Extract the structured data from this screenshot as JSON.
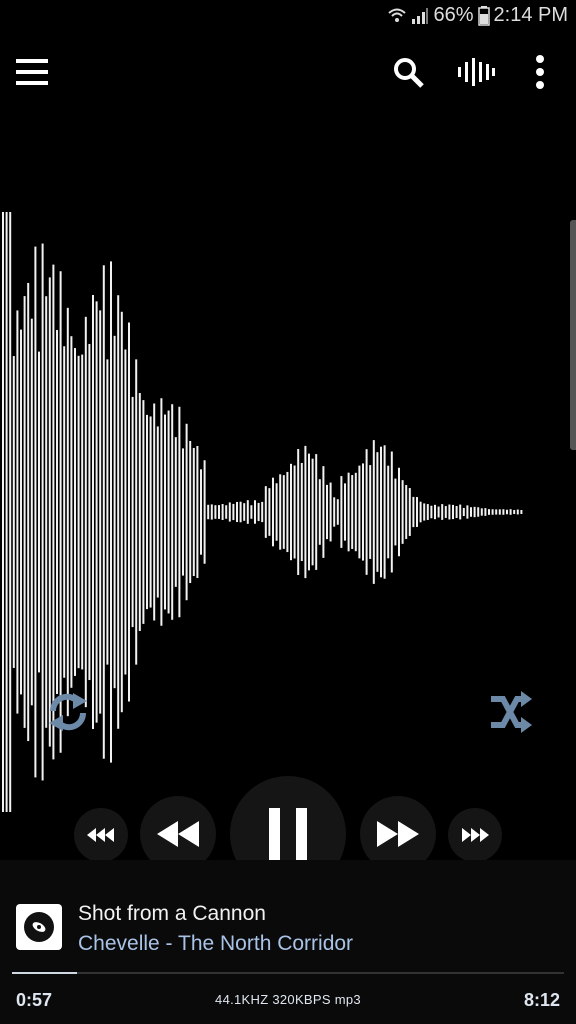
{
  "status": {
    "battery": "66%",
    "time": "2:14 PM"
  },
  "toolbar": {
    "menu_icon": "hamburger-menu-icon",
    "search_icon": "search-icon",
    "visualizer_icon": "waveform-icon",
    "overflow_icon": "more-vert-icon"
  },
  "player": {
    "repeat_icon": "repeat-icon",
    "shuffle_icon": "shuffle-icon",
    "controls": [
      "fast-rewind",
      "rewind",
      "pause",
      "forward",
      "fast-forward"
    ],
    "accent": "#6d89a8"
  },
  "now_playing": {
    "title": "Shot from a Cannon",
    "artist_album": "Chevelle - The North Corridor",
    "elapsed": "0:57",
    "duration": "8:12",
    "format": "44.1KHZ  320KBPS  mp3",
    "progress": 0.117
  }
}
